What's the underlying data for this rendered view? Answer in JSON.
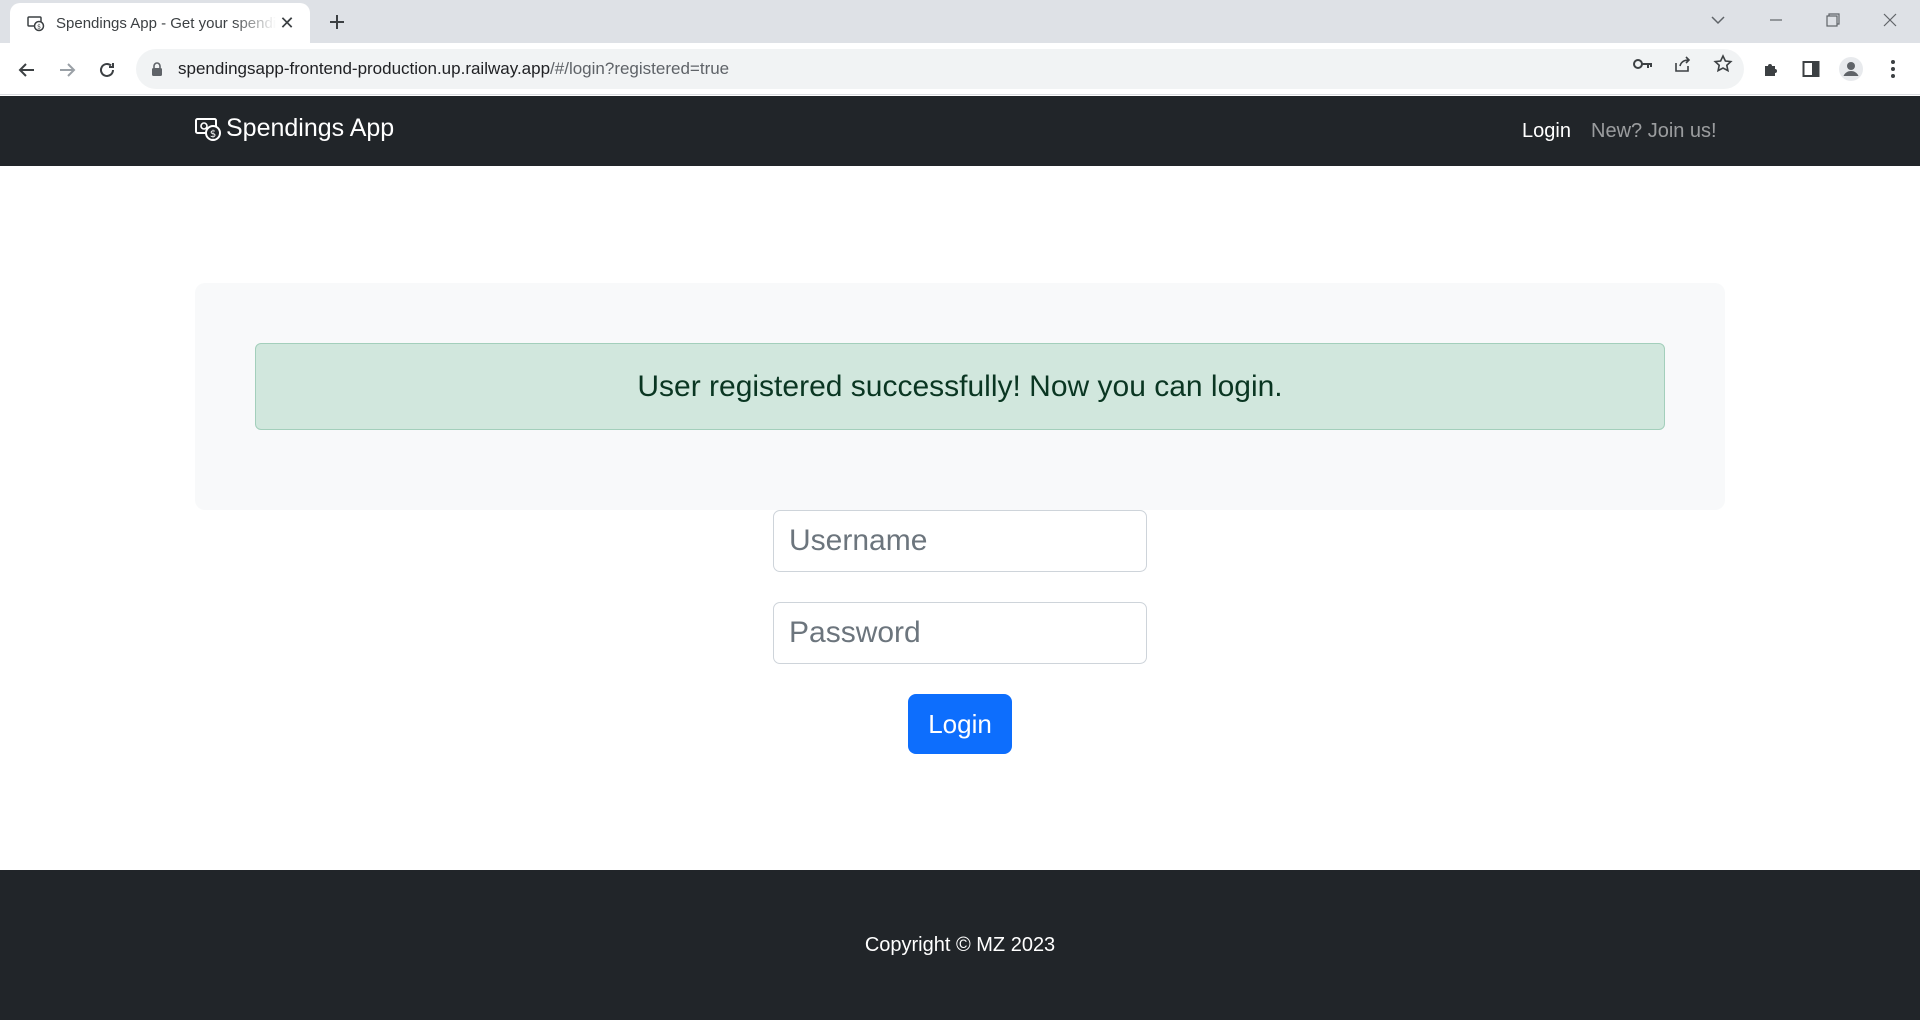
{
  "browser": {
    "tab_title": "Spendings App - Get your spending",
    "url_domain": "spendingsapp-frontend-production.up.railway.app",
    "url_path": "/#/login?registered=true"
  },
  "navbar": {
    "brand": "Spendings App",
    "login_link": "Login",
    "join_link": "New? Join us!"
  },
  "alert": {
    "message": "User registered successfully! Now you can login."
  },
  "form": {
    "username_placeholder": "Username",
    "password_placeholder": "Password",
    "login_button": "Login"
  },
  "footer": {
    "copyright": "Copyright © MZ 2023"
  },
  "colors": {
    "navbar_bg": "#212529",
    "alert_bg": "#d1e7dd",
    "alert_text": "#0a3622",
    "primary_button": "#0d6efd"
  }
}
